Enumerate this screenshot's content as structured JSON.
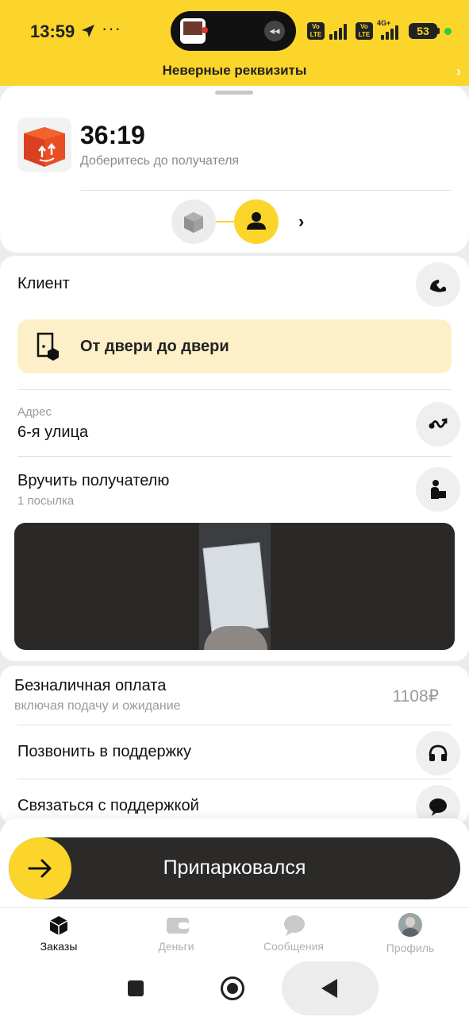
{
  "status_bar": {
    "time": "13:59",
    "more": "···",
    "network": "4G+",
    "battery": "53",
    "volte_label": "Vo LTE",
    "nav_icon": "location-arrow-icon",
    "mute_icon": "vibrate-icon"
  },
  "banner": {
    "text": "Неверные реквизиты",
    "chevron": "›"
  },
  "order": {
    "timer": "36:19",
    "subtitle": "Доберитесь до получателя",
    "box_icon": "package-up-icon",
    "steps": [
      {
        "icon": "parcel-icon",
        "state": "done"
      },
      {
        "icon": "person-icon",
        "state": "active"
      }
    ],
    "steps_chevron": "›"
  },
  "client": {
    "label": "Клиент",
    "call_icon": "phone-icon",
    "delivery_type": "От двери до двери",
    "delivery_icon": "door-parcel-icon"
  },
  "address": {
    "caption": "Адрес",
    "value": "6-я улица",
    "route_icon": "route-icon"
  },
  "handover": {
    "label": "Вручить получателю",
    "count": "1 посылка",
    "icon": "person-parcel-icon"
  },
  "payment": {
    "label": "Безналичная оплата",
    "sub": "включая подачу и ожидание",
    "amount": "1108₽"
  },
  "support": {
    "call_label": "Позвонить в поддержку",
    "call_icon": "headset-icon",
    "chat_label": "Связаться с поддержкой",
    "chat_icon": "chat-bubble-icon"
  },
  "swipe": {
    "label": "Припарковался",
    "icon": "arrow-right-icon"
  },
  "tabs": [
    {
      "label": "Заказы",
      "icon": "box-icon",
      "active": true
    },
    {
      "label": "Деньги",
      "icon": "wallet-icon",
      "active": false
    },
    {
      "label": "Сообщения",
      "icon": "message-icon",
      "active": false
    },
    {
      "label": "Профиль",
      "icon": "avatar",
      "active": false
    }
  ],
  "colors": {
    "accent": "#fcd52b",
    "dark": "#2b2a29",
    "muted": "#9a9a9a"
  }
}
